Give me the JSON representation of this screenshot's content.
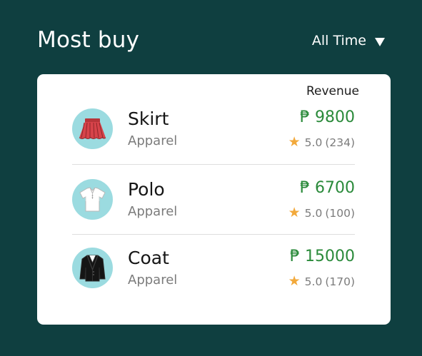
{
  "header": {
    "title": "Most buy",
    "filter_label": "All Time"
  },
  "table": {
    "revenue_header": "Revenue"
  },
  "items": [
    {
      "name": "Skirt",
      "category": "Apparel",
      "price": "₱ 9800",
      "rating": "5.0",
      "reviews": "(234)",
      "icon": "skirt-icon"
    },
    {
      "name": "Polo",
      "category": "Apparel",
      "price": "₱ 6700",
      "rating": "5.0",
      "reviews": "(100)",
      "icon": "polo-shirt-icon"
    },
    {
      "name": "Coat",
      "category": "Apparel",
      "price": "₱ 15000",
      "rating": "5.0",
      "reviews": "(170)",
      "icon": "coat-icon"
    }
  ],
  "colors": {
    "background": "#0f3f40",
    "card": "#ffffff",
    "price": "#2a8a3a",
    "star": "#f2a93b",
    "avatar_bg": "#9bdbe0"
  }
}
